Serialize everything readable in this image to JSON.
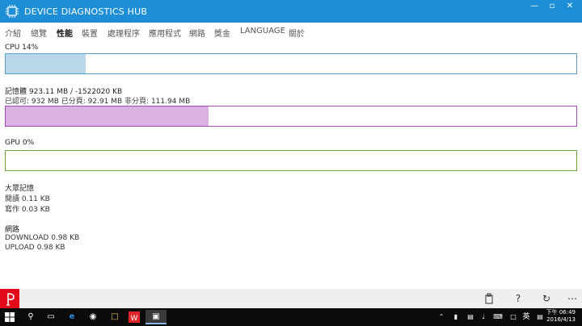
{
  "window": {
    "title": "DEVICE DIAGNOSTICS HUB"
  },
  "tabs": [
    {
      "label": "介紹"
    },
    {
      "label": "總覽"
    },
    {
      "label": "性能"
    },
    {
      "label": "裝置"
    },
    {
      "label": "處理程序"
    },
    {
      "label": "應用程式"
    },
    {
      "label": "網路"
    },
    {
      "label": "獎金"
    },
    {
      "label": "LANGUAGE"
    },
    {
      "label": "關於"
    }
  ],
  "cpu": {
    "label": "CPU 14%",
    "percent": 14,
    "color": "#b9d6ea",
    "border": "#5aa0cf"
  },
  "memory": {
    "label": "記憶體 923.11 MB / -1522020 KB",
    "detail": "已認可: 932 MB  已分頁: 92.91 MB  非分頁: 111.94 MB",
    "fraction": 0.355,
    "color": "#d9b2e2",
    "border": "#a64ab3"
  },
  "gpu": {
    "label": "GPU 0%",
    "percent": 0,
    "border": "#6aaa3c"
  },
  "storage": {
    "title": "大眾記憶",
    "read": "閱讀 0.11 KB",
    "write": "寫作 0.03 KB"
  },
  "network": {
    "title": "網路",
    "download": "DOWNLOAD 0.98 KB",
    "upload": "UPLOAD 0.98 KB"
  },
  "taskbar": {
    "time": "下午 06:49",
    "date": "2016/4/13",
    "lang": "英"
  }
}
